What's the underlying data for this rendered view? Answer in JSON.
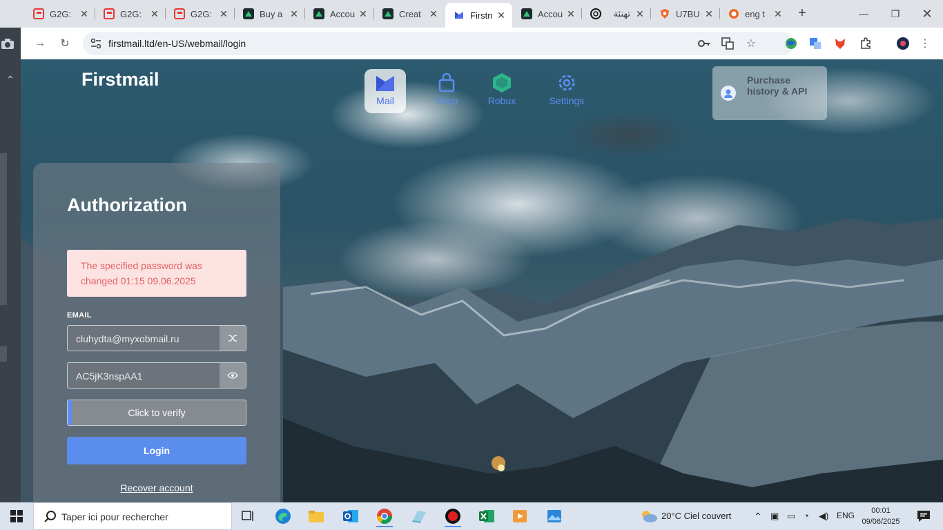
{
  "tabs": [
    {
      "title": "G2G:",
      "icon": "g2g-icon"
    },
    {
      "title": "G2G:",
      "icon": "g2g-icon"
    },
    {
      "title": "G2G:",
      "icon": "g2g-icon"
    },
    {
      "title": "Buy a",
      "icon": "game-icon"
    },
    {
      "title": "Accou",
      "icon": "game-icon"
    },
    {
      "title": "Creat",
      "icon": "game-icon"
    },
    {
      "title": "Firstn",
      "icon": "firstmail-icon",
      "active": true
    },
    {
      "title": "Accou",
      "icon": "game-icon"
    },
    {
      "title": "تهنئة",
      "icon": "chatgpt-icon"
    },
    {
      "title": "U7BU",
      "icon": "shield-icon"
    },
    {
      "title": "eng t",
      "icon": "record-icon"
    }
  ],
  "browser": {
    "url": "firstmail.ltd/en-US/webmail/login"
  },
  "site": {
    "brand": "Firstmail",
    "nav": [
      {
        "label": "Mail",
        "icon": "mail-icon",
        "active": true
      },
      {
        "label": "Shop",
        "icon": "shop-icon"
      },
      {
        "label": "Robux",
        "icon": "robux-icon"
      },
      {
        "label": "Settings",
        "icon": "settings-icon"
      }
    ],
    "purchase_label": "Purchase history & API"
  },
  "auth": {
    "title": "Authorization",
    "alert": "The specified password was changed 01:15 09.06.2025",
    "email_label": "EMAIL",
    "email_value": "cluhydta@myxobmail.ru",
    "password_value": "AC5jK3nspAA1",
    "verify_label": "Click to verify",
    "login_label": "Login",
    "recover_label": "Recover account"
  },
  "taskbar": {
    "search_placeholder": "Taper ici pour rechercher",
    "weather": "20°C  Ciel couvert",
    "lang": "ENG",
    "time": "00:01",
    "date": "09/06/2025"
  },
  "colors": {
    "accent": "#5b8def",
    "alert_bg": "#fde2e2",
    "alert_text": "#e06262"
  }
}
